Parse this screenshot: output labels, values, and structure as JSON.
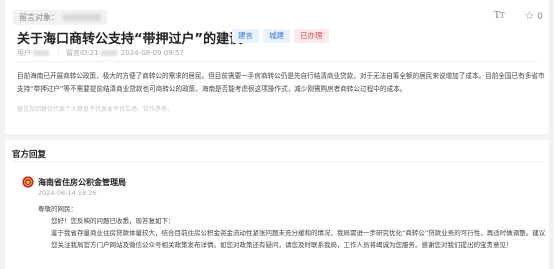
{
  "message": {
    "target_label": "留言对象：",
    "title": "关于海口商转公支持“带押过户”的建议",
    "tags": [
      "建言",
      "城建",
      "已办理"
    ],
    "author_prefix": "用户",
    "id_label": "留言ID:21",
    "date": "2024-08-09 09:57",
    "content": "目前海南已开展商转公政策，极大的方便了商转公的需求的居民。但目前需要一手房商转公仍是先自行结清商业贷款，对于无法自筹全额的居民来说增加了成本。目前全国已有多省市支持“带押过户”等不需要提前结清商业贷款也可商转公的政策，海南是否能考虑很这项操作式，减少刚需购房者商转公过程中的成本。",
    "notice": "留言及回复仅代表个人意见不代表本平台立场，仅作参考。"
  },
  "reply": {
    "section_title": "官方回复",
    "org_name": "海南省住房公积金管理局",
    "time": "2024-06-14 18:26",
    "greeting": "尊敬的网民：",
    "line1": "您好！您反映的问题已收悉，现答复如下：",
    "line2": "鉴于我省存量商业住房贷款体量较大，结合目前住房公积金资金流动性紧张问题未充分缓和的情况，我局需进一步研究优化“商转公”贷款业务的可行性，再适时做调整。建议您关注我局官方门户网站及微信公众号相关政策发布详情。如您对政策还有疑问，请您及时联系我局，工作人员将竭诚为您服务。感谢您对我们提出的宝贵意见！"
  },
  "icons": {
    "font_size": "font-size-icon",
    "favorite": "star-icon",
    "favorite_count": "0"
  },
  "colors": {
    "tag_blue": "#3b78e7",
    "tag_red": "#e34d4d",
    "logo_red": "#c62828"
  }
}
